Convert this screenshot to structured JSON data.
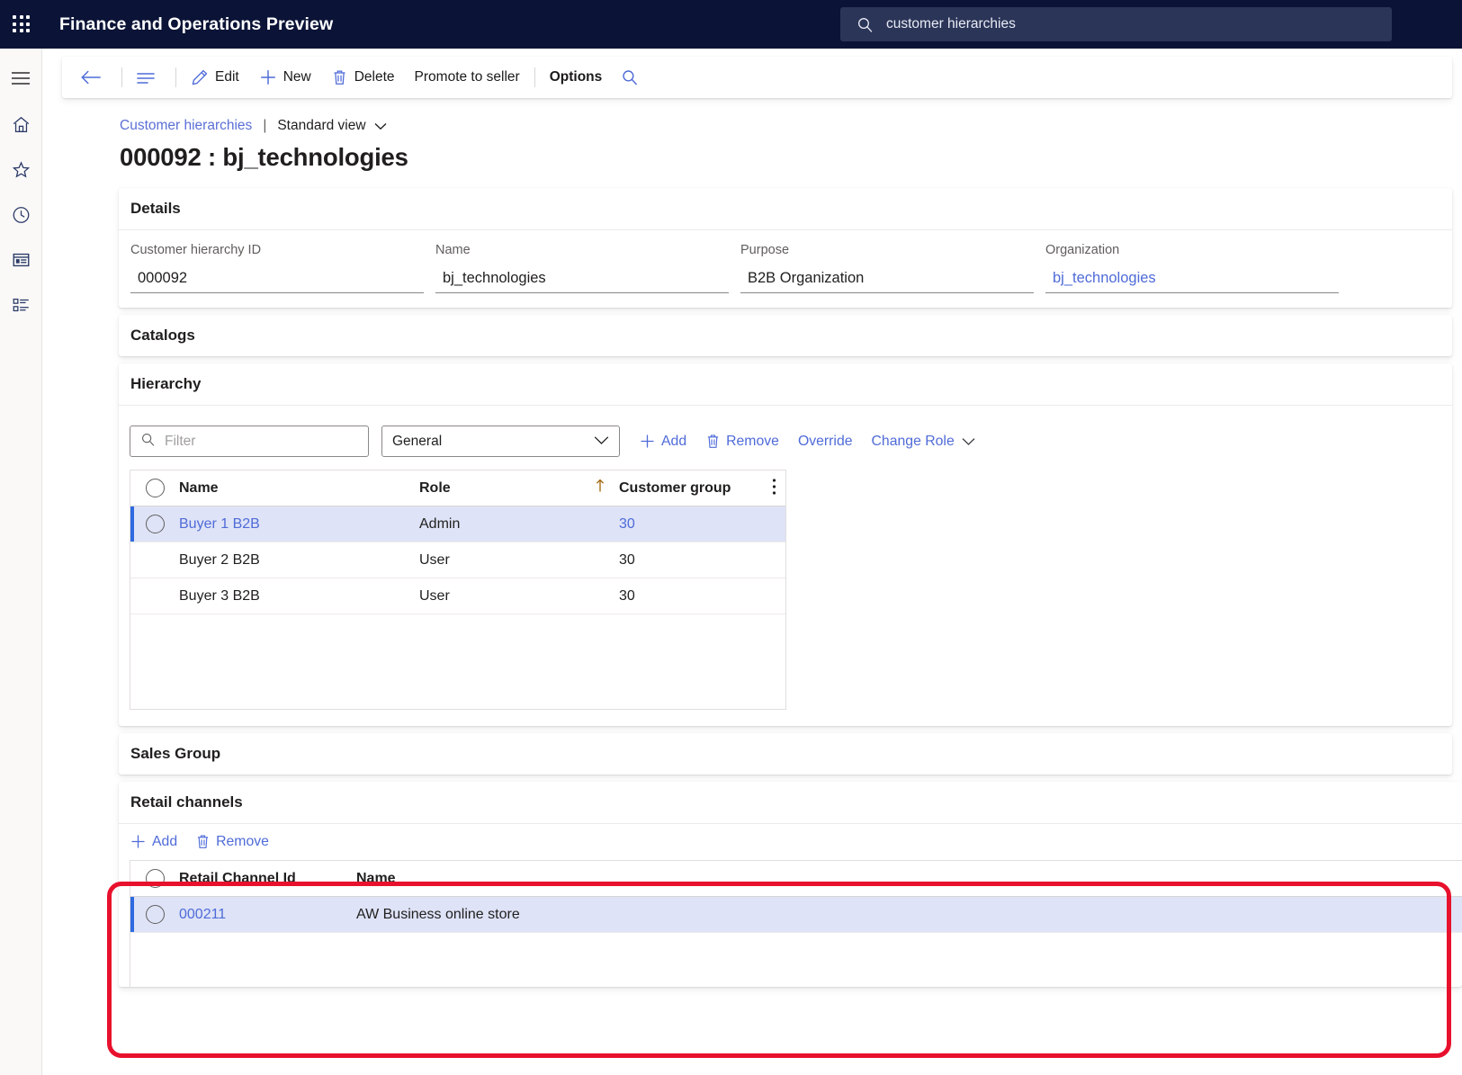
{
  "topbar": {
    "waffle_icon": "waffle-grid-icon",
    "app_title": "Finance and Operations Preview",
    "search": {
      "icon": "search-icon",
      "value": "customer hierarchies"
    }
  },
  "rail": {
    "items": [
      {
        "icon": "hamburger-menu-icon",
        "name": "nav-toggle"
      },
      {
        "icon": "home-icon",
        "name": "home"
      },
      {
        "icon": "star-icon",
        "name": "favorites"
      },
      {
        "icon": "clock-icon",
        "name": "recent"
      },
      {
        "icon": "workspace-icon",
        "name": "workspaces"
      },
      {
        "icon": "modules-list-icon",
        "name": "modules"
      }
    ]
  },
  "commandbar": {
    "back_icon": "back-arrow-icon",
    "show_list_icon": "show-list-icon",
    "edit_icon": "pencil-icon",
    "edit_label": "Edit",
    "new_icon": "plus-icon",
    "new_label": "New",
    "delete_icon": "trash-icon",
    "delete_label": "Delete",
    "promote_label": "Promote to seller",
    "options_label": "Options",
    "search_icon": "search-icon"
  },
  "breadcrumb": {
    "parent": "Customer hierarchies",
    "divider": "|",
    "view": "Standard view",
    "chevron_icon": "chevron-down-icon"
  },
  "page_title": "000092 : bj_technologies",
  "sections": {
    "details": {
      "title": "Details",
      "fields": [
        {
          "label": "Customer hierarchy ID",
          "value": "000092",
          "is_link": false
        },
        {
          "label": "Name",
          "value": "bj_technologies",
          "is_link": false
        },
        {
          "label": "Purpose",
          "value": "B2B Organization",
          "is_link": false
        },
        {
          "label": "Organization",
          "value": "bj_technologies",
          "is_link": true
        }
      ]
    },
    "catalogs": {
      "title": "Catalogs"
    },
    "hierarchy": {
      "title": "Hierarchy",
      "toolbar": {
        "filter_icon": "search-icon",
        "filter_placeholder": "Filter",
        "filter_value": "",
        "select_value": "General",
        "select_chevron_icon": "chevron-down-icon",
        "add_icon": "plus-icon",
        "add_label": "Add",
        "remove_icon": "trash-icon",
        "remove_label": "Remove",
        "override_label": "Override",
        "change_role_label": "Change Role",
        "change_role_chevron_icon": "chevron-down-icon"
      },
      "grid": {
        "select_all_icon": "radio-circle-icon",
        "columns": [
          "Name",
          "Role",
          "Customer group"
        ],
        "sort_indicator_icon": "sort-ascending-arrow-icon",
        "column_options_icon": "more-vertical-icon",
        "rows": [
          {
            "name": "Buyer 1 B2B",
            "role": "Admin",
            "customer_group": "30",
            "selected": true
          },
          {
            "name": "Buyer 2 B2B",
            "role": "User",
            "customer_group": "30",
            "selected": false
          },
          {
            "name": "Buyer 3 B2B",
            "role": "User",
            "customer_group": "30",
            "selected": false
          }
        ]
      }
    },
    "sales_group": {
      "title": "Sales Group"
    },
    "retail_channels": {
      "title": "Retail channels",
      "toolbar": {
        "add_icon": "plus-icon",
        "add_label": "Add",
        "remove_icon": "trash-icon",
        "remove_label": "Remove"
      },
      "grid": {
        "select_all_icon": "radio-circle-icon",
        "columns": [
          "Retail Channel Id",
          "Name"
        ],
        "rows": [
          {
            "retail_channel_id": "000211",
            "name": "AW Business online store",
            "selected": true
          }
        ]
      },
      "highlight_color": "#e8112d"
    }
  },
  "colors": {
    "topbar_bg": "#0b1437",
    "accent_link": "#4f6bd8",
    "selected_row_bg": "#dee3f7",
    "selection_bar": "#2f6ae0",
    "highlight_outline": "#e8112d"
  }
}
